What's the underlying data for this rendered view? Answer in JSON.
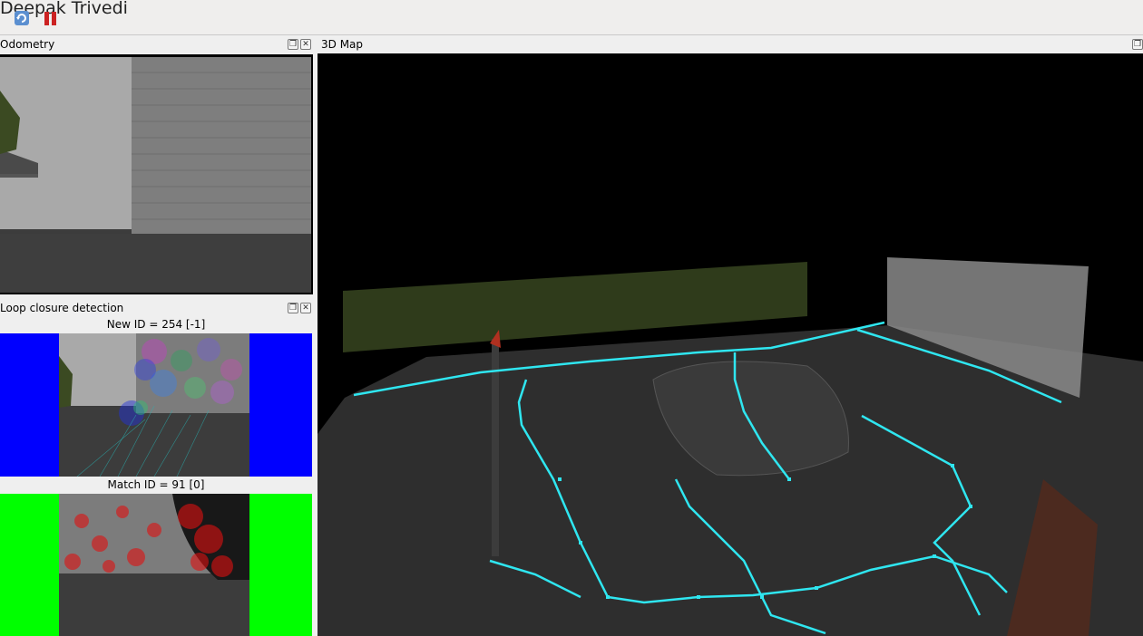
{
  "window": {
    "title": "Deepak Trivedi"
  },
  "toolbar": {
    "buttons": [
      {
        "icon": "refresh-icon",
        "accent": "#4a7fc1"
      },
      {
        "icon": "pause-icon",
        "accent": "#cc2222"
      }
    ]
  },
  "odometry": {
    "title": "Odometry"
  },
  "loop_closure": {
    "title": "Loop closure detection",
    "new_id_label": "New ID = 254 [-1]",
    "match_id_label": "Match ID = 91 [0]",
    "new_border_color": "#0000ff",
    "match_border_color": "#00ff00"
  },
  "map3d": {
    "title": "3D Map",
    "trajectory_color": "#2fe6f0"
  },
  "dock_controls": {
    "float": "❐",
    "close": "✕"
  }
}
